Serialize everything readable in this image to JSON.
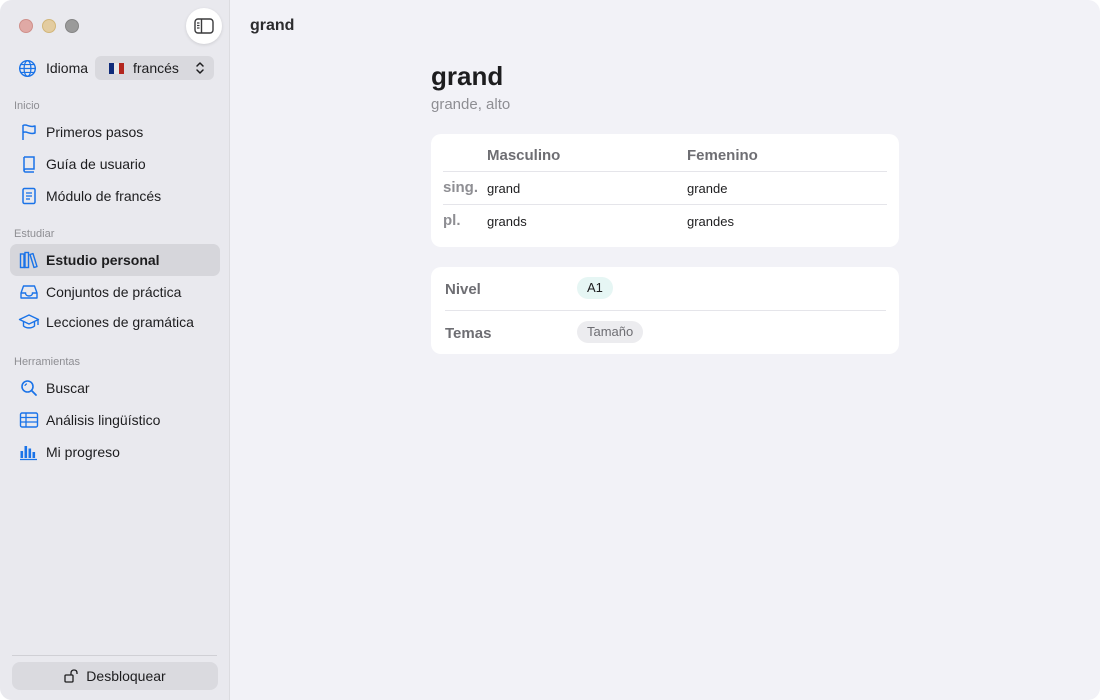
{
  "window": {
    "title": "grand"
  },
  "sidebar": {
    "language": {
      "label": "Idioma",
      "value": "francés"
    },
    "sections": [
      {
        "title": "Inicio",
        "items": [
          {
            "label": "Primeros pasos",
            "icon": "flag-icon"
          },
          {
            "label": "Guía de usuario",
            "icon": "book-icon"
          },
          {
            "label": "Módulo de francés",
            "icon": "document-icon"
          }
        ]
      },
      {
        "title": "Estudiar",
        "items": [
          {
            "label": "Estudio personal",
            "icon": "books-icon",
            "active": true
          },
          {
            "label": "Conjuntos de práctica",
            "icon": "tray-icon"
          },
          {
            "label": "Lecciones de gramática",
            "icon": "graduation-cap-icon"
          }
        ]
      },
      {
        "title": "Herramientas",
        "items": [
          {
            "label": "Buscar",
            "icon": "search-icon"
          },
          {
            "label": "Análisis lingüístico",
            "icon": "table-icon"
          },
          {
            "label": "Mi progreso",
            "icon": "bar-chart-icon"
          }
        ]
      }
    ],
    "unlock_label": "Desbloquear"
  },
  "entry": {
    "word": "grand",
    "translation": "grande, alto",
    "forms": {
      "headers": [
        "Masculino",
        "Femenino"
      ],
      "rows": [
        {
          "label": "sing.",
          "masculine": "grand",
          "feminine": "grande"
        },
        {
          "label": "pl.",
          "masculine": "grands",
          "feminine": "grandes"
        }
      ]
    },
    "meta": {
      "level_label": "Nivel",
      "level_value": "A1",
      "topics_label": "Temas",
      "topics_value": "Tamaño"
    }
  },
  "colors": {
    "accent": "#1a73e8",
    "sidebar_bg": "#e9e9ee",
    "main_bg": "#f2f2f7",
    "level_pill": "#e6f6f4",
    "flag_blue": "#0f2b7a",
    "flag_white": "#e6e6e6",
    "flag_red": "#b3261e"
  }
}
